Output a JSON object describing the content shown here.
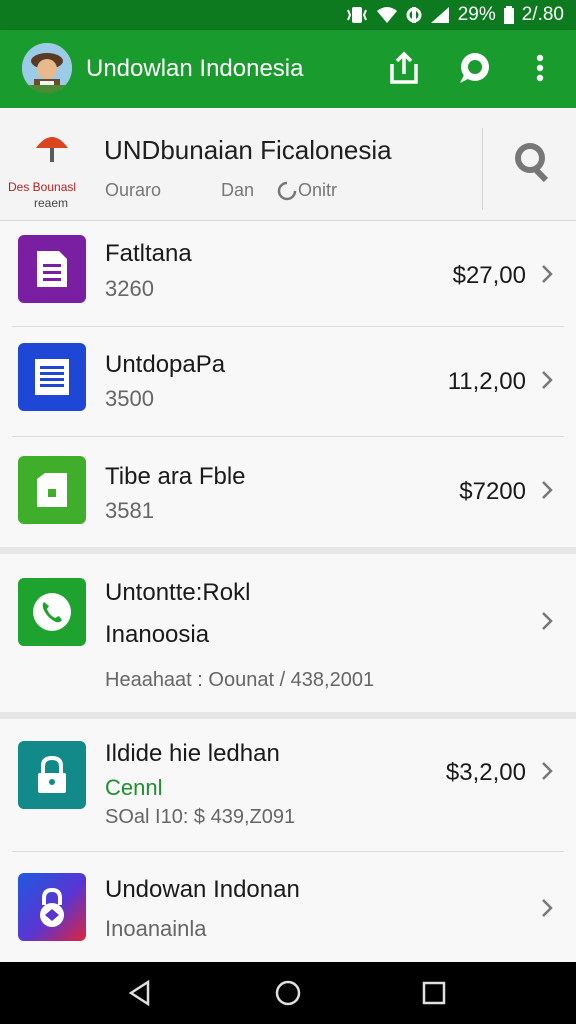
{
  "status_bar": {
    "battery": "29%",
    "time": "2/.80"
  },
  "app_bar": {
    "title": "Undowlan Indonesia"
  },
  "header": {
    "title": "UNDbunaian Ficalonesia",
    "logo_text_1": "Des Bounasl",
    "logo_text_2": "reaem",
    "sub_1": "Ouraro",
    "sub_2": "Dan",
    "sub_3": "Onitr"
  },
  "items": [
    {
      "name": "Fatltana",
      "sub": "3260",
      "amount": "$27,00",
      "icon": "document-icon",
      "color": "#7b1fa2"
    },
    {
      "name": "UntdopaPa",
      "sub": "3500",
      "amount": "11,2,00",
      "icon": "list-document-icon",
      "color": "#1e47d6"
    },
    {
      "name": "Tibe ara Fble",
      "sub": "3581",
      "amount": "$7200",
      "icon": "file-icon",
      "color": "#3fae2a"
    },
    {
      "name": "Untontte:Rokl",
      "sub": "Inanoosia",
      "extra": "Heaahaat : Oounat / 438,2001",
      "icon": "phone-icon",
      "color": "#1ea32e"
    },
    {
      "name": "Ildide hie ledhan",
      "sub": "Cennl",
      "extra": "SOal I10: $ 439,Z091",
      "amount": "$3,2,00",
      "icon": "lock-icon",
      "color": "#138a8a"
    },
    {
      "name": "Undowan Indonan",
      "sub": "Inoanainla",
      "icon": "secure-lock-icon",
      "color": "#3b3bd8"
    }
  ]
}
